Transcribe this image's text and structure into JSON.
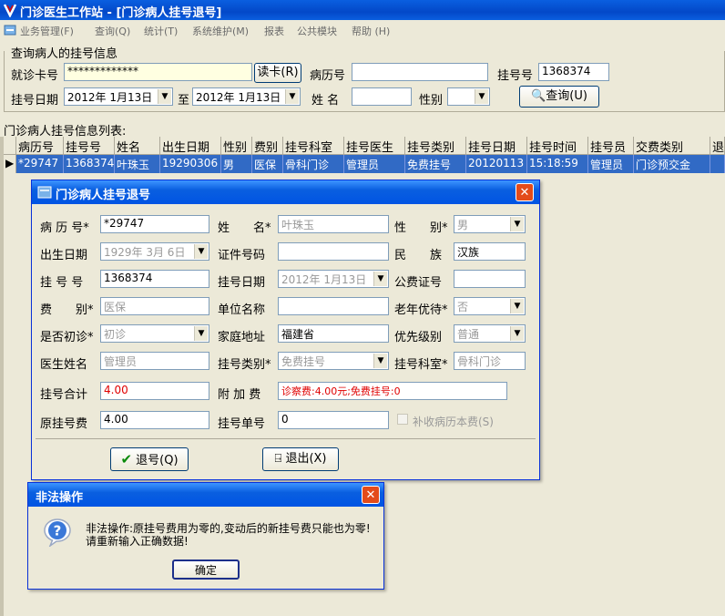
{
  "window": {
    "title": "门诊医生工作站 - [门诊病人挂号退号]"
  },
  "menu": [
    "业务管理(F)",
    "查询(Q)",
    "统计(T)",
    "系统维护(M)",
    "报表",
    "公共模块",
    "帮助 (H)"
  ],
  "query": {
    "legend": "查询病人的挂号信息",
    "card_label": "就诊卡号",
    "card_value": "*************",
    "read_card_btn": "读卡(R)",
    "record_label": "病历号",
    "record_value": "",
    "reg_no_label": "挂号号",
    "reg_no_value": "1368374",
    "date_label": "挂号日期",
    "date_from": "2012年 1月13日",
    "to_label": "至",
    "date_to": "2012年 1月13日",
    "name_label": "姓 名",
    "name_value": "",
    "sex_label": "性别",
    "sex_value": "",
    "query_btn": "查询(U)"
  },
  "list": {
    "title": "门诊病人挂号信息列表:",
    "columns": [
      "病历号",
      "挂号号",
      "姓名",
      "出生日期",
      "性别",
      "费别",
      "挂号科室",
      "挂号医生",
      "挂号类别",
      "挂号日期",
      "挂号时间",
      "挂号员",
      "交费类别",
      "退"
    ],
    "rows": [
      [
        "*29747",
        "1368374",
        "叶珠玉",
        "19290306",
        "男",
        "医保",
        "骨科门诊",
        "管理员",
        "免费挂号",
        "20120113",
        "15:18:59",
        "管理员",
        "门诊预交金",
        ""
      ]
    ]
  },
  "dialog": {
    "title": "门诊病人挂号退号",
    "fields": {
      "record_label": "病 历 号*",
      "record_value": "*29747",
      "name_label": "姓　　名*",
      "name_value": "叶珠玉",
      "sex_label": "性　　别*",
      "sex_value": "男",
      "birth_label": "出生日期",
      "birth_value": "1929年 3月 6日",
      "id_label": "证件号码",
      "id_value": "",
      "nation_label": "民　　族",
      "nation_value": "汉族",
      "regno_label": "挂 号 号",
      "regno_value": "1368374",
      "regdate_label": "挂号日期",
      "regdate_value": "2012年 1月13日",
      "public_label": "公费证号",
      "public_value": "",
      "fee_label": "费　　别*",
      "fee_value": "医保",
      "unit_label": "单位名称",
      "unit_value": "",
      "elder_label": "老年优待*",
      "elder_value": "否",
      "first_label": "是否初诊*",
      "first_value": "初诊",
      "addr_label": "家庭地址",
      "addr_value": "福建省",
      "priority_label": "优先级别",
      "priority_value": "普通",
      "doctor_label": "医生姓名",
      "doctor_value": "管理员",
      "regtype_label": "挂号类别*",
      "regtype_value": "免费挂号",
      "dept_label": "挂号科室*",
      "dept_value": "骨科门诊",
      "total_label": "挂号合计",
      "total_value": "4.00",
      "extra_label": "附 加 费",
      "extra_value": "诊察费:4.00元;免费挂号:0",
      "orig_label": "原挂号费",
      "orig_value": "4.00",
      "slip_label": "挂号单号",
      "slip_value": "0",
      "book_label": "补收病历本费(S)"
    },
    "cancel_btn": "退号(Q)",
    "exit_btn": "退出(X)"
  },
  "alert": {
    "title": "非法操作",
    "line1": "非法操作:原挂号费用为零的,变动后的新挂号费只能也为零!",
    "line2": "请重新输入正确数据!",
    "ok_btn": "确定"
  }
}
